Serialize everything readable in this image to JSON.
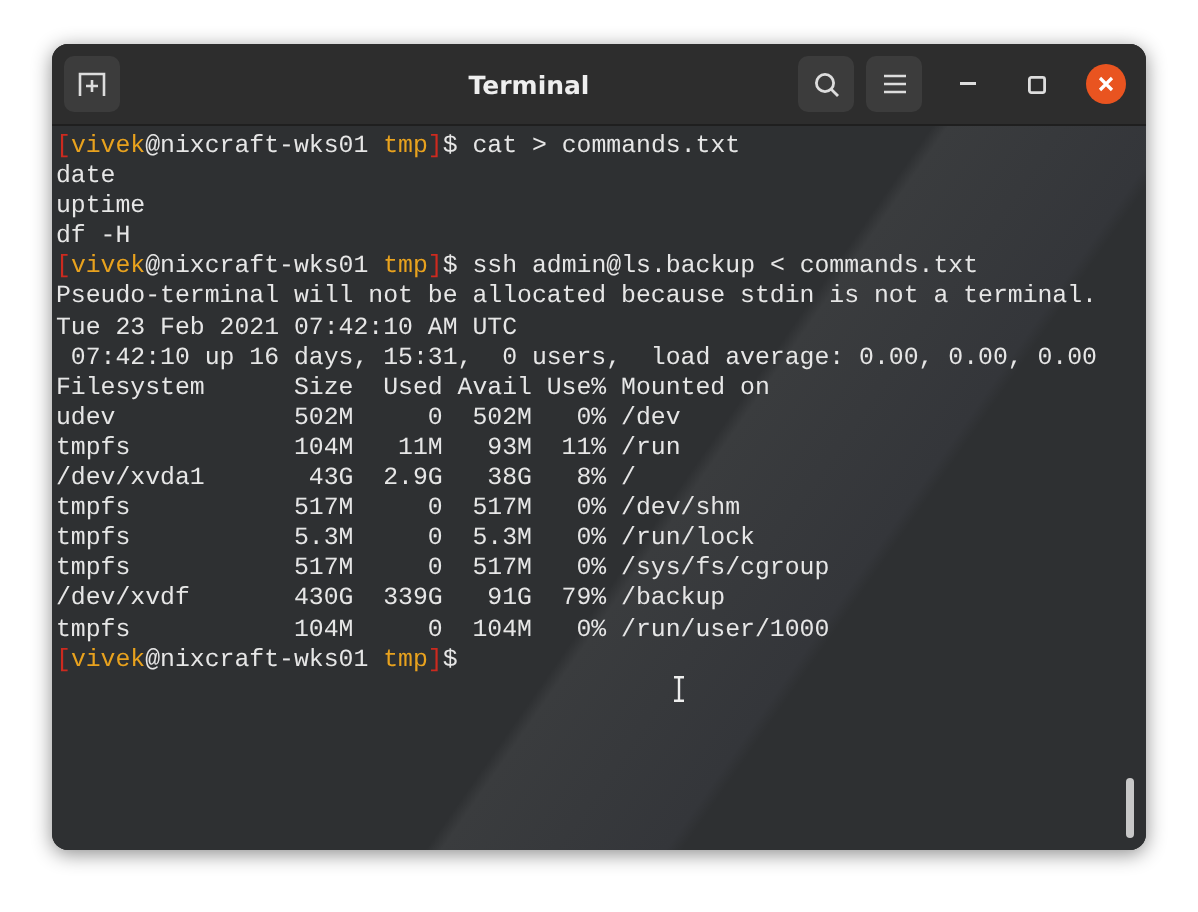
{
  "window": {
    "title": "Terminal"
  },
  "terminal": {
    "lines": [
      {
        "kind": "prompt",
        "open": "[",
        "user": "vivek",
        "host": "@nixcraft-wks01",
        "dir": "tmp",
        "close": "]",
        "command": "$ cat > commands.txt"
      },
      {
        "kind": "output",
        "text": "date"
      },
      {
        "kind": "output",
        "text": "uptime"
      },
      {
        "kind": "output",
        "text": "df -H"
      },
      {
        "kind": "prompt",
        "open": "[",
        "user": "vivek",
        "host": "@nixcraft-wks01",
        "dir": "tmp",
        "close": "]",
        "command": "$ ssh admin@ls.backup < commands.txt"
      },
      {
        "kind": "output",
        "text": "Pseudo-terminal will not be allocated because stdin is not a terminal."
      },
      {
        "kind": "output",
        "text": "Tue 23 Feb 2021 07:42:10 AM UTC"
      },
      {
        "kind": "output",
        "text": " 07:42:10 up 16 days, 15:31,  0 users,  load average: 0.00, 0.00, 0.00"
      },
      {
        "kind": "output",
        "text": "Filesystem      Size  Used Avail Use% Mounted on"
      },
      {
        "kind": "output",
        "text": "udev            502M     0  502M   0% /dev"
      },
      {
        "kind": "output",
        "text": "tmpfs           104M   11M   93M  11% /run"
      },
      {
        "kind": "output",
        "text": "/dev/xvda1       43G  2.9G   38G   8% /"
      },
      {
        "kind": "output",
        "text": "tmpfs           517M     0  517M   0% /dev/shm"
      },
      {
        "kind": "output",
        "text": "tmpfs           5.3M     0  5.3M   0% /run/lock"
      },
      {
        "kind": "output",
        "text": "tmpfs           517M     0  517M   0% /sys/fs/cgroup"
      },
      {
        "kind": "output",
        "text": "/dev/xvdf       430G  339G   91G  79% /backup"
      },
      {
        "kind": "output",
        "text": "tmpfs           104M     0  104M   0% /run/user/1000"
      },
      {
        "kind": "prompt",
        "open": "[",
        "user": "vivek",
        "host": "@nixcraft-wks01",
        "dir": "tmp",
        "close": "]",
        "command": "$"
      }
    ]
  }
}
